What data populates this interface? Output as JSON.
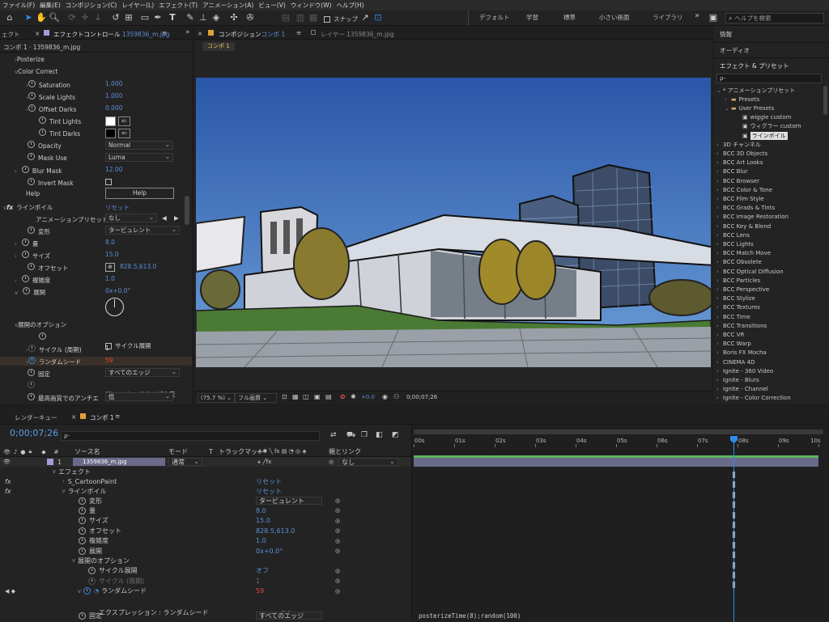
{
  "menu": [
    "ファイル(F)",
    "編集(E)",
    "コンポジション(C)",
    "レイヤー(L)",
    "エフェクト(T)",
    "アニメーション(A)",
    "ビュー(V)",
    "ウィンドウ(W)",
    "ヘルプ(H)"
  ],
  "toolbar": {
    "snap_label": "スナップ",
    "workspaces": [
      "デフォルト",
      "学習",
      "標準",
      "小さい画面",
      "ライブラリ"
    ],
    "more": "»",
    "help_search_placeholder": "ヘルプを検索"
  },
  "effect_controls": {
    "left_tab": "ェクト",
    "tab_label": "エフェクトコントロール",
    "tab_file": "1359836_m.jpg",
    "menu_icon": "≡",
    "breadcrumb": "コンポ 1 · 1359836_m.jpg",
    "rows": {
      "posterize": "Posterize",
      "color_correct": "Color Correct",
      "saturation": "Saturation",
      "saturation_val": "1.000",
      "scale_lights": "Scale Lights",
      "scale_lights_val": "1.000",
      "offset_darks": "Offset Darks",
      "offset_darks_val": "0.000",
      "tint_lights": "Tint Lights",
      "tint_darks": "Tint Darks",
      "opacity": "Opacity",
      "opacity_val": "Normal",
      "mask_use": "Mask Use",
      "mask_use_val": "Luma",
      "blur_mask": "Blur Mask",
      "blur_mask_val": "12.00",
      "invert_mask": "Invert Mask",
      "help_label": "Help",
      "help_button": "Help",
      "fx": "fx",
      "linepoil": "ラインボイル",
      "reset": "リセット",
      "anim_preset": "アニメーションプリセット",
      "anim_preset_val": "なし",
      "transform": "変形",
      "transform_val": "タービュレント",
      "amount": "量",
      "amount_val": "8.0",
      "size": "サイズ",
      "size_val": "15.0",
      "offset": "オフセット",
      "offset_val": "828.5,613.0",
      "complexity": "複雑度",
      "complexity_val": "1.0",
      "evolution": "展開",
      "evolution_val": "0x+0.0°",
      "evolution_options": "展開のオプション",
      "cycle_evolution": "サイクル展開",
      "cycle_period": "サイクル (周期)",
      "cycle_period_val": "1",
      "random_seed": "ランダムシード",
      "random_seed_val": "59",
      "fixed": "固定",
      "fixed_val": "すべてのエッジ",
      "resize_layer": "レイヤーのサイズを変",
      "best_quality": "最高画質でのアンチエ",
      "best_quality_val": "低"
    }
  },
  "composition": {
    "tab_label": "コンポジション",
    "tab_comp": "コンポ 1",
    "layer_tab": "レイヤー 1359836_m.jpg",
    "sub_tab": "コンポ 1",
    "zoom": "(75.7 %)",
    "resolution": "フル画質",
    "exposure": "+0.0",
    "timecode": "0;00;07;26"
  },
  "right_panel": {
    "info": "情報",
    "audio": "オーディオ",
    "effects_presets": "エフェクト & プリセット",
    "search_placeholder": "ρ-",
    "tree": [
      {
        "label": "* アニメーションプリセット",
        "indent": 0,
        "arrow": "v"
      },
      {
        "label": "Presets",
        "indent": 1,
        "arrow": ">",
        "folder": true
      },
      {
        "label": "User Presets",
        "indent": 1,
        "arrow": "v",
        "folder": true
      },
      {
        "label": "wiggle custom",
        "indent": 2,
        "file": true
      },
      {
        "label": "ウィグラー custom",
        "indent": 2,
        "file": true
      },
      {
        "label": "ラインボイル",
        "indent": 2,
        "file": true,
        "selected": true
      },
      {
        "label": "3D チャンネル",
        "indent": 0,
        "arrow": ">"
      },
      {
        "label": "BCC 3D Objects",
        "indent": 0,
        "arrow": ">"
      },
      {
        "label": "BCC Art Looks",
        "indent": 0,
        "arrow": ">"
      },
      {
        "label": "BCC Blur",
        "indent": 0,
        "arrow": ">"
      },
      {
        "label": "BCC Browser",
        "indent": 0,
        "arrow": ">"
      },
      {
        "label": "BCC Color & Tone",
        "indent": 0,
        "arrow": ">"
      },
      {
        "label": "BCC Film Style",
        "indent": 0,
        "arrow": ">"
      },
      {
        "label": "BCC Grads & Tints",
        "indent": 0,
        "arrow": ">"
      },
      {
        "label": "BCC Image Restoration",
        "indent": 0,
        "arrow": ">"
      },
      {
        "label": "BCC Key & Blend",
        "indent": 0,
        "arrow": ">"
      },
      {
        "label": "BCC Lens",
        "indent": 0,
        "arrow": ">"
      },
      {
        "label": "BCC Lights",
        "indent": 0,
        "arrow": ">"
      },
      {
        "label": "BCC Match Move",
        "indent": 0,
        "arrow": ">"
      },
      {
        "label": "BCC Obsolete",
        "indent": 0,
        "arrow": ">"
      },
      {
        "label": "BCC Optical Diffusion",
        "indent": 0,
        "arrow": ">"
      },
      {
        "label": "BCC Particles",
        "indent": 0,
        "arrow": ">"
      },
      {
        "label": "BCC Perspective",
        "indent": 0,
        "arrow": ">"
      },
      {
        "label": "BCC Stylize",
        "indent": 0,
        "arrow": ">"
      },
      {
        "label": "BCC Textures",
        "indent": 0,
        "arrow": ">"
      },
      {
        "label": "BCC Time",
        "indent": 0,
        "arrow": ">"
      },
      {
        "label": "BCC Transitions",
        "indent": 0,
        "arrow": ">"
      },
      {
        "label": "BCC VR",
        "indent": 0,
        "arrow": ">"
      },
      {
        "label": "BCC Warp",
        "indent": 0,
        "arrow": ">"
      },
      {
        "label": "Boris FX Mocha",
        "indent": 0,
        "arrow": ">"
      },
      {
        "label": "CINEMA 4D",
        "indent": 0,
        "arrow": ">"
      },
      {
        "label": "Ignite - 360 Video",
        "indent": 0,
        "arrow": ">"
      },
      {
        "label": "Ignite - Blurs",
        "indent": 0,
        "arrow": ">"
      },
      {
        "label": "Ignite - Channel",
        "indent": 0,
        "arrow": ">"
      },
      {
        "label": "Ignite - Color Correction",
        "indent": 0,
        "arrow": ">"
      }
    ]
  },
  "timeline": {
    "render_queue_tab": "レンダーキュー",
    "comp_tab": "コンポ 1",
    "timecode": "0;00;07;26",
    "col_source": "ソース名",
    "col_mode": "モード",
    "col_t": "T",
    "col_trackmatte": "トラックマット",
    "col_parent": "親とリンク",
    "layer_num": "1",
    "layer_name": "1359836_m.jpg",
    "layer_mode": "通常",
    "layer_parent": "なし",
    "effects": "エフェクト",
    "cartoon": "S_CartoonPaint",
    "cartoon_reset": "リセット",
    "linepoil": "ラインボイル",
    "linepoil_reset": "リセット",
    "props": [
      {
        "name": "変形",
        "val": "タービュレント"
      },
      {
        "name": "量",
        "val": "8.0"
      },
      {
        "name": "サイズ",
        "val": "15.0"
      },
      {
        "name": "オフセット",
        "val": "828.5,613.0"
      },
      {
        "name": "複雑度",
        "val": "1.0"
      },
      {
        "name": "展開",
        "val": "0x+0.0°"
      }
    ],
    "evo_options": "展開のオプション",
    "cycle_evo": "サイクル展開",
    "cycle_evo_val": "オフ",
    "cycle_period": "サイクル (周期)",
    "cycle_period_val": "1",
    "random_seed": "ランダムシード",
    "random_seed_val": "59",
    "expression_label": "エクスプレッション : ランダムシード",
    "expression": "posterizeTime(8);random(100)",
    "fixed": "固定",
    "fixed_val": "すべてのエッジ",
    "ruler": [
      "00s",
      "01s",
      "02s",
      "03s",
      "04s",
      "05s",
      "06s",
      "07s",
      "08s",
      "09s",
      "10s"
    ],
    "playhead": 7.9
  },
  "colors": {
    "accent": "#2d8ceb",
    "timecode": "#5a9fe6",
    "track_green": "#5fb35f",
    "layer_bar": "#6a6a8a",
    "red": "#e04b3a"
  }
}
